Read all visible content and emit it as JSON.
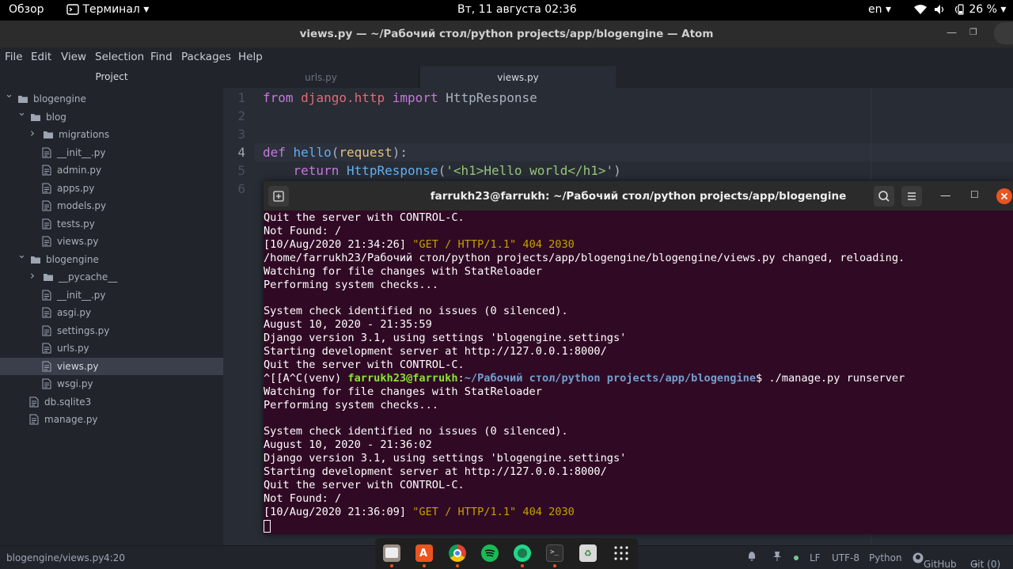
{
  "topbar": {
    "overview": "Обзор",
    "app_menu": "Терминал",
    "clock": "Вт, 11 августа  02:36",
    "lang": "en",
    "battery": "26 %"
  },
  "atom": {
    "window_title": "views.py — ~/Рабочий стол/python projects/app/blogengine — Atom",
    "menu": [
      "File",
      "Edit",
      "View",
      "Selection",
      "Find",
      "Packages",
      "Help"
    ],
    "tree_header": "Project",
    "tree": [
      {
        "label": "blogengine",
        "type": "folder-open"
      },
      {
        "label": "blog",
        "type": "folder-open"
      },
      {
        "label": "migrations",
        "type": "folder-closed"
      },
      {
        "label": "__init__.py",
        "type": "file"
      },
      {
        "label": "admin.py",
        "type": "file"
      },
      {
        "label": "apps.py",
        "type": "file"
      },
      {
        "label": "models.py",
        "type": "file"
      },
      {
        "label": "tests.py",
        "type": "file"
      },
      {
        "label": "views.py",
        "type": "file"
      },
      {
        "label": "blogengine",
        "type": "folder-open"
      },
      {
        "label": "__pycache__",
        "type": "folder-closed"
      },
      {
        "label": "__init__.py",
        "type": "file"
      },
      {
        "label": "asgi.py",
        "type": "file"
      },
      {
        "label": "settings.py",
        "type": "file"
      },
      {
        "label": "urls.py",
        "type": "file"
      },
      {
        "label": "views.py",
        "type": "file",
        "selected": true
      },
      {
        "label": "wsgi.py",
        "type": "file"
      },
      {
        "label": "db.sqlite3",
        "type": "file"
      },
      {
        "label": "manage.py",
        "type": "file"
      }
    ],
    "tabs": [
      {
        "label": "urls.py",
        "active": false
      },
      {
        "label": "views.py",
        "active": true
      }
    ],
    "line_numbers": [
      "1",
      "2",
      "3",
      "4",
      "5",
      "6"
    ],
    "code": {
      "l1": {
        "kw1": "from",
        "mod": "django.http",
        "kw2": "import",
        "name": "HttpResponse"
      },
      "l4": {
        "kw": "def",
        "fn": "hello",
        "open": "(",
        "param": "request",
        "close": "):"
      },
      "l5": {
        "kw": "return",
        "cls": "HttpResponse",
        "open": "(",
        "str": "'<h1>Hello world</h1>'",
        "close": ")"
      }
    },
    "status": {
      "path": "blogengine/views.py",
      "cursor": "4:20",
      "eol": "LF",
      "encoding": "UTF-8",
      "grammar": "Python",
      "github": "GitHub",
      "git": "Git (0)"
    }
  },
  "terminal": {
    "title": "farrukh23@farrukh: ~/Рабочий стол/python projects/app/blogengine",
    "lines": [
      {
        "plain": "Quit the server with CONTROL-C."
      },
      {
        "plain": "Not Found: /"
      },
      {
        "pre": "[10/Aug/2020 21:34:26] ",
        "hl": "\"GET / HTTP/1.1\" 404 2030"
      },
      {
        "plain": "/home/farrukh23/Рабочий стол/python projects/app/blogengine/blogengine/views.py changed, reloading."
      },
      {
        "plain": "Watching for file changes with StatReloader"
      },
      {
        "plain": "Performing system checks..."
      },
      {
        "plain": ""
      },
      {
        "plain": "System check identified no issues (0 silenced)."
      },
      {
        "plain": "August 10, 2020 - 21:35:59"
      },
      {
        "plain": "Django version 3.1, using settings 'blogengine.settings'"
      },
      {
        "plain": "Starting development server at http://127.0.0.1:8000/"
      },
      {
        "plain": "Quit the server with CONTROL-C."
      },
      {
        "prompt_pre": "^[[A^C(venv) ",
        "user": "farrukh23@farrukh",
        "colon": ":",
        "path": "~/Рабочий стол/python projects/app/blogengine",
        "cmd": "$ ./manage.py runserver"
      },
      {
        "plain": "Watching for file changes with StatReloader"
      },
      {
        "plain": "Performing system checks..."
      },
      {
        "plain": ""
      },
      {
        "plain": "System check identified no issues (0 silenced)."
      },
      {
        "plain": "August 10, 2020 - 21:36:02"
      },
      {
        "plain": "Django version 3.1, using settings 'blogengine.settings'"
      },
      {
        "plain": "Starting development server at http://127.0.0.1:8000/"
      },
      {
        "plain": "Quit the server with CONTROL-C."
      },
      {
        "plain": "Not Found: /"
      },
      {
        "pre": "[10/Aug/2020 21:36:09] ",
        "hl": "\"GET / HTTP/1.1\" 404 2030"
      }
    ]
  },
  "dock": {
    "apps": [
      "files-icon",
      "software-center-icon",
      "chrome-icon",
      "spotify-icon",
      "pycharm-icon",
      "terminal-icon",
      "trash-icon",
      "app-grid-icon"
    ]
  },
  "colors": {
    "terminal_bg": "#300a24",
    "editor_bg": "#282c34",
    "ubuntu_orange": "#e95420"
  }
}
